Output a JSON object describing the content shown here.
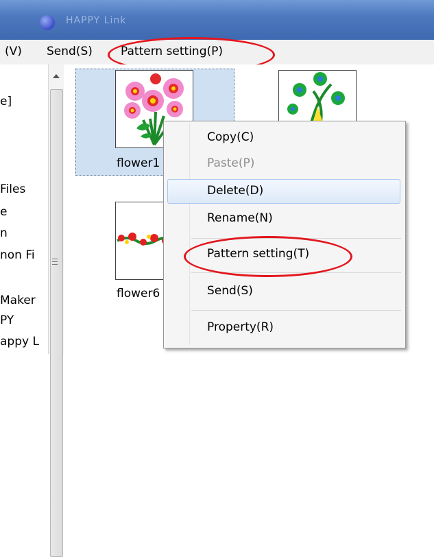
{
  "window": {
    "title": "HAPPY Link"
  },
  "menubar": {
    "items": [
      "(V)",
      "Send(S)",
      "Pattern setting(P)"
    ]
  },
  "left_panel": {
    "items": [
      "e]",
      "Files",
      "e",
      "n",
      "non Fi",
      "Maker",
      "PY",
      "appy L"
    ]
  },
  "thumbnails": [
    {
      "caption": "flower1"
    },
    {
      "caption": ""
    },
    {
      "caption": "flower6"
    }
  ],
  "context_menu": {
    "items": [
      {
        "label": "Copy(C)",
        "enabled": true
      },
      {
        "label": "Paste(P)",
        "enabled": false
      },
      {
        "label": "Delete(D)",
        "enabled": true,
        "hovered": true
      },
      {
        "label": "Rename(N)",
        "enabled": true
      },
      {
        "label": "Pattern setting(T)",
        "enabled": true
      },
      {
        "label": "Send(S)",
        "enabled": true
      },
      {
        "label": "Property(R)",
        "enabled": true
      }
    ]
  },
  "colors": {
    "annotation": "#e3161d",
    "selection": "#cfe0f3",
    "titlebar": "#4e79bf"
  }
}
